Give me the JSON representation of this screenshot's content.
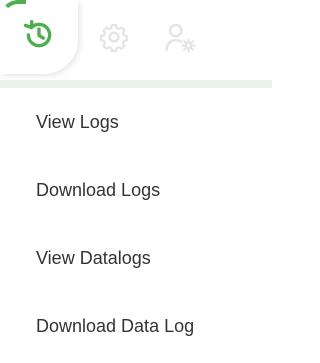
{
  "toolbar": {
    "tabs": [
      {
        "icon": "history-icon",
        "active": true
      },
      {
        "icon": "gear-icon",
        "active": false
      },
      {
        "icon": "user-settings-icon",
        "active": false
      }
    ]
  },
  "menu": {
    "items": [
      {
        "label": "View Logs"
      },
      {
        "label": "Download Logs"
      },
      {
        "label": "View Datalogs"
      },
      {
        "label": "Download Data Log"
      }
    ]
  },
  "colors": {
    "accent": "#4caf50",
    "inactive_icon": "#e6e6e6",
    "band": "#eaf3ea",
    "text": "#333333"
  }
}
